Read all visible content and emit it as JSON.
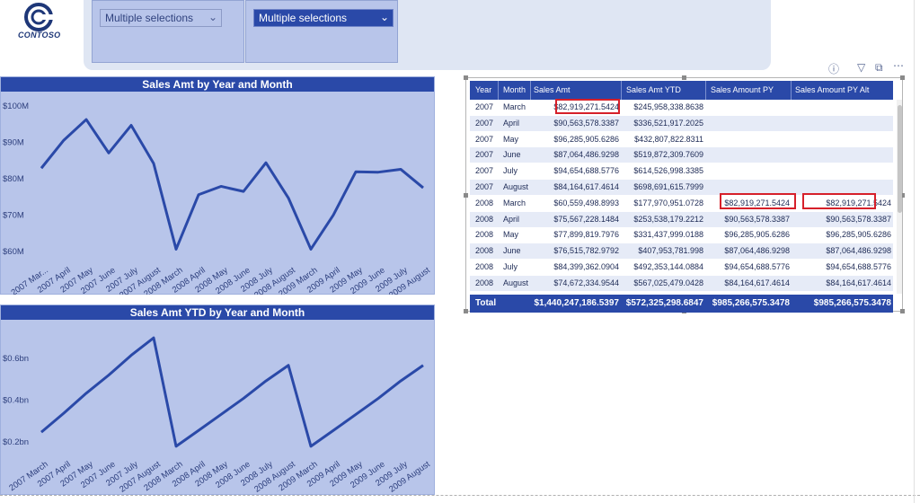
{
  "logo": {
    "icon": "contoso-logo-icon",
    "text": "CONTOSO"
  },
  "slicers": [
    {
      "value": "Multiple selections",
      "style": "light"
    },
    {
      "value": "Multiple selections",
      "style": "dark"
    }
  ],
  "visual_header_icons": [
    "info-icon",
    "filter-icon",
    "focus-mode-icon",
    "more-options-icon"
  ],
  "chart_data": [
    {
      "type": "line",
      "title": "Sales Amt by Year and Month",
      "xlabel": "",
      "ylabel": "",
      "categories": [
        "2007 Mar...",
        "2007 April",
        "2007 May",
        "2007 June",
        "2007 July",
        "2007 August",
        "2008 March",
        "2008 April",
        "2008 May",
        "2008 June",
        "2008 July",
        "2008 August",
        "2009 March",
        "2009 April",
        "2009 May",
        "2009 June",
        "2009 July",
        "2009 August"
      ],
      "tick_labels": [
        "2007 Mar...",
        "2007 April",
        "2007 May",
        "2007 June",
        "2007 July",
        "2007 August",
        "2008 March",
        "2008 April",
        "2008 May",
        "2008 June",
        "2008 July",
        "2008 August",
        "2009 March",
        "2009 April",
        "2009 May",
        "2009 June",
        "2009 July",
        "2009 August"
      ],
      "series": [
        {
          "values": [
            82.9,
            90.6,
            96.3,
            87.1,
            94.7,
            84.2,
            60.6,
            75.6,
            77.9,
            76.5,
            84.4,
            74.7,
            60.6,
            70.0,
            81.9,
            81.8,
            82.6,
            77.5
          ]
        }
      ],
      "yticks": [
        "$60M",
        "$70M",
        "$80M",
        "$90M",
        "$100M"
      ],
      "ytick_values": [
        60,
        70,
        80,
        90,
        100
      ],
      "ylim": [
        57,
        102
      ],
      "color": "#2a49a8"
    },
    {
      "type": "line",
      "title": "Sales Amt YTD by Year and Month",
      "xlabel": "",
      "ylabel": "",
      "categories": [
        "2007 March",
        "2007 April",
        "2007 May",
        "2007 June",
        "2007 July",
        "2007 August",
        "2008 March",
        "2008 April",
        "2008 May",
        "2008 June",
        "2008 July",
        "2008 August",
        "2009 March",
        "2009 April",
        "2009 May",
        "2009 June",
        "2009 July",
        "2009 August"
      ],
      "tick_labels": [
        "2007 March",
        "2007 April",
        "2007 May",
        "2007 June",
        "2007 July",
        "2007 August",
        "2008 March",
        "2008 April",
        "2008 May",
        "2008 June",
        "2008 July",
        "2008 August",
        "2009 March",
        "2009 April",
        "2009 May",
        "2009 June",
        "2009 July",
        "2009 August"
      ],
      "series": [
        {
          "values": [
            0.246,
            0.337,
            0.433,
            0.52,
            0.615,
            0.699,
            0.178,
            0.254,
            0.331,
            0.408,
            0.492,
            0.567,
            0.178,
            0.254,
            0.331,
            0.408,
            0.492,
            0.567
          ]
        }
      ],
      "yticks": [
        "$0.2bn",
        "$0.4bn",
        "$0.6bn"
      ],
      "ytick_values": [
        0.2,
        0.4,
        0.6
      ],
      "ylim": [
        0.13,
        0.76
      ],
      "color": "#2a49a8"
    }
  ],
  "table": {
    "columns": [
      "Year",
      "Month",
      "Sales Amt",
      "Sales Amt YTD",
      "Sales Amount PY",
      "Sales Amount PY Alt"
    ],
    "rows": [
      [
        "2007",
        "March",
        "$82,919,271.5424",
        "$245,958,338.8638",
        "",
        ""
      ],
      [
        "2007",
        "April",
        "$90,563,578.3387",
        "$336,521,917.2025",
        "",
        ""
      ],
      [
        "2007",
        "May",
        "$96,285,905.6286",
        "$432,807,822.8311",
        "",
        ""
      ],
      [
        "2007",
        "June",
        "$87,064,486.9298",
        "$519,872,309.7609",
        "",
        ""
      ],
      [
        "2007",
        "July",
        "$94,654,688.5776",
        "$614,526,998.3385",
        "",
        ""
      ],
      [
        "2007",
        "August",
        "$84,164,617.4614",
        "$698,691,615.7999",
        "",
        ""
      ],
      [
        "2008",
        "March",
        "$60,559,498.8993",
        "$177,970,951.0728",
        "$82,919,271.5424",
        "$82,919,271.5424"
      ],
      [
        "2008",
        "April",
        "$75,567,228.1484",
        "$253,538,179.2212",
        "$90,563,578.3387",
        "$90,563,578.3387"
      ],
      [
        "2008",
        "May",
        "$77,899,819.7976",
        "$331,437,999.0188",
        "$96,285,905.6286",
        "$96,285,905.6286"
      ],
      [
        "2008",
        "June",
        "$76,515,782.9792",
        "$407,953,781.998",
        "$87,064,486.9298",
        "$87,064,486.9298"
      ],
      [
        "2008",
        "July",
        "$84,399,362.0904",
        "$492,353,144.0884",
        "$94,654,688.5776",
        "$94,654,688.5776"
      ],
      [
        "2008",
        "August",
        "$74,672,334.9544",
        "$567,025,479.0428",
        "$84,164,617.4614",
        "$84,164,617.4614"
      ]
    ],
    "total": [
      "Total",
      "$1,440,247,186.5397",
      "$572,325,298.6847",
      "$985,266,575.3478",
      "$985,266,575.3478"
    ]
  },
  "colors": {
    "accent": "#2a49a8",
    "panel": "#b8c5ea",
    "highlight": "#d6202a"
  }
}
